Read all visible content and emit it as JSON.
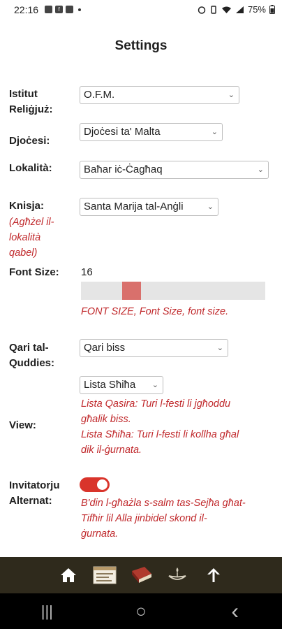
{
  "status_bar": {
    "time": "22:16",
    "battery": "75%"
  },
  "page": {
    "title": "Settings"
  },
  "fields": {
    "istitut": {
      "label_line1": "Istitut",
      "label_line2": "Reliġjuż:",
      "value": "O.F.M."
    },
    "djocesi": {
      "label": "Djoċesi:",
      "value": "Djoċesi ta' Malta"
    },
    "lokalita": {
      "label": "Lokalità:",
      "value": "Baħar iċ-Ċagħaq"
    },
    "knisja": {
      "label": "Knisja:",
      "hint_line1": "(Agħżel il-",
      "hint_line2": "lokalità",
      "hint_line3": "qabel)",
      "value": "Santa Marija tal-Anġli"
    },
    "font_size": {
      "label": "Font Size:",
      "value": "16",
      "slider_fraction": 0.25,
      "sample_text": "FONT SIZE, Font Size, font size."
    },
    "qari": {
      "label_line1": "Qari tal-",
      "label_line2": "Quddies:",
      "value": "Qari biss"
    },
    "view": {
      "label": "View:",
      "value": "Lista Sħiħa",
      "desc_line1": "Lista Qasira: Turi l-festi li jgħoddu",
      "desc_line2": "għalik biss.",
      "desc_line3": "Lista Sħiħa: Turi l-festi li kollha għal",
      "desc_line4": "dik il-ġurnata."
    },
    "invitatorju": {
      "label_line1": "Invitatorju",
      "label_line2": "Alternat:",
      "enabled": true,
      "desc_line1": "B'din l-għażla s-salm tas-Sejħa għat-",
      "desc_line2": "Tifħir lil Alla jinbidel skond il-",
      "desc_line3": "ġurnata."
    }
  },
  "bottom_nav": {
    "icons": [
      "home-icon",
      "calendar-card-icon",
      "book-icon",
      "lamp-icon",
      "arrow-up-icon"
    ]
  },
  "system_nav": {
    "recents": "|||",
    "home": "○",
    "back": "‹"
  },
  "colors": {
    "accent_red": "#c0282b",
    "toggle_on": "#d9342b",
    "slider_thumb": "#d9706c",
    "nav_bg": "#2f2a1c"
  }
}
